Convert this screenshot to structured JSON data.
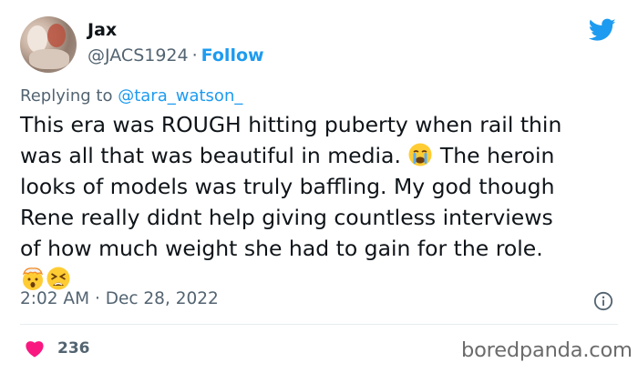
{
  "author": {
    "name": "Jax",
    "handle": "@JACS1924",
    "separator": "·",
    "follow_label": "Follow"
  },
  "reply": {
    "prefix": "Replying to",
    "mention": "@tara_watson_"
  },
  "tweet": {
    "line1": "This era was ROUGH hitting puberty when rail thin",
    "line2_before": "was all that was beautiful in media.",
    "line2_after": "The heroin",
    "line3": "looks of models was truly baffling. My god though",
    "line4": "Rene really didnt help giving countless interviews",
    "line5": "of how much weight she had to gain for the role.",
    "emojis": [
      "crying-face",
      "exploding-head",
      "tired-face"
    ]
  },
  "meta": {
    "time": "2:02 AM",
    "separator": "·",
    "date": "Dec 28, 2022"
  },
  "engagement": {
    "likes": "236"
  },
  "colors": {
    "accent": "#1d9bf0",
    "heart": "#f91880",
    "muted": "#536471"
  },
  "watermark": "boredpanda.com"
}
